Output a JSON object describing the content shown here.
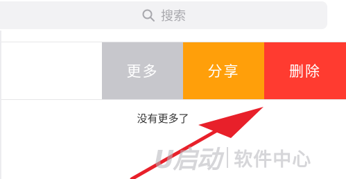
{
  "search": {
    "placeholder_text": "搜索",
    "icon": "search-icon"
  },
  "swipe_actions": {
    "more": "更多",
    "share": "分享",
    "delete": "删除"
  },
  "footer": {
    "no_more_text": "没有更多了"
  },
  "watermark": {
    "logo": "U启动",
    "site": "软件中心"
  },
  "colors": {
    "more": "#c7c7cc",
    "share": "#ff9f0a",
    "delete": "#ff3b30",
    "arrow": "#e8202a"
  }
}
